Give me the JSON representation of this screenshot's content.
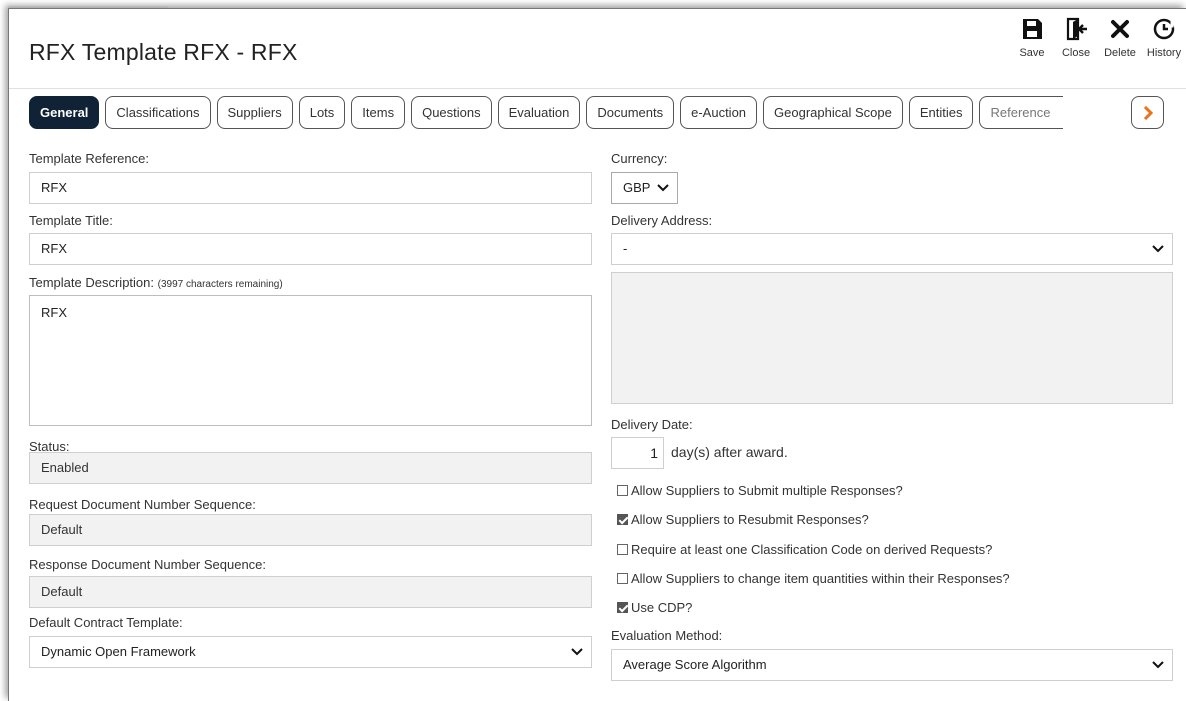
{
  "window": {
    "title": "RFX Template RFX - RFX"
  },
  "toolbar": {
    "save": "Save",
    "close": "Close",
    "delete": "Delete",
    "history": "History"
  },
  "tabs": [
    {
      "label": "General",
      "active": true
    },
    {
      "label": "Classifications"
    },
    {
      "label": "Suppliers"
    },
    {
      "label": "Lots"
    },
    {
      "label": "Items"
    },
    {
      "label": "Questions"
    },
    {
      "label": "Evaluation"
    },
    {
      "label": "Documents"
    },
    {
      "label": "e-Auction"
    },
    {
      "label": "Geographical Scope"
    },
    {
      "label": "Entities"
    },
    {
      "label": "Reference"
    }
  ],
  "form": {
    "template_reference": {
      "label": "Template Reference:",
      "value": "RFX"
    },
    "template_title": {
      "label": "Template Title:",
      "value": "RFX"
    },
    "template_description": {
      "label": "Template Description:",
      "hint": "(3997 characters remaining)",
      "value": "RFX"
    },
    "status": {
      "label": "Status:",
      "value": "Enabled"
    },
    "request_seq": {
      "label": "Request Document Number Sequence:",
      "value": "Default"
    },
    "response_seq": {
      "label": "Response Document Number Sequence:",
      "value": "Default"
    },
    "contract_template": {
      "label": "Default Contract Template:",
      "value": "Dynamic Open Framework"
    },
    "currency": {
      "label": "Currency:",
      "value": "GBP"
    },
    "delivery_address": {
      "label": "Delivery Address:",
      "value": "-"
    },
    "delivery_date": {
      "label": "Delivery Date:",
      "value": "1",
      "suffix": "day(s) after award."
    },
    "checks": [
      {
        "label": "Allow Suppliers to Submit multiple Responses?",
        "checked": false
      },
      {
        "label": "Allow Suppliers to Resubmit Responses?",
        "checked": true
      },
      {
        "label": "Require at least one Classification Code on derived Requests?",
        "checked": false
      },
      {
        "label": "Allow Suppliers to change item quantities within their Responses?",
        "checked": false
      },
      {
        "label": "Use CDP?",
        "checked": true
      }
    ],
    "evaluation_method": {
      "label": "Evaluation Method:",
      "value": "Average Score Algorithm"
    }
  }
}
